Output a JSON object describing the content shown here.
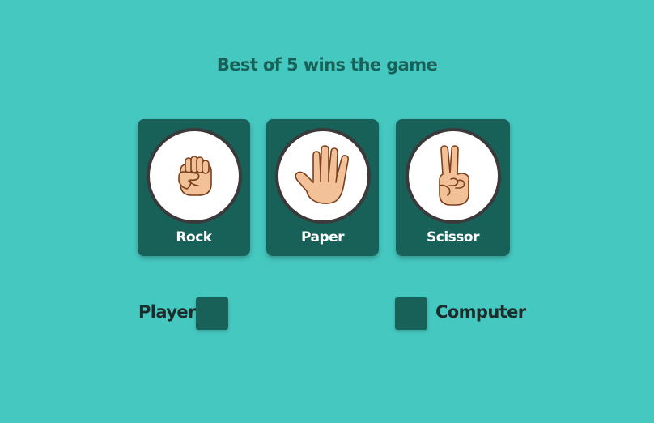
{
  "game": {
    "title": "Best of 5 wins the game"
  },
  "choices": [
    {
      "label": "Rock",
      "icon": "fist-hand-icon"
    },
    {
      "label": "Paper",
      "icon": "open-hand-icon"
    },
    {
      "label": "Scissor",
      "icon": "victory-hand-icon"
    }
  ],
  "scoreboard": {
    "player_label": "Player",
    "player_score": "",
    "computer_label": "Computer",
    "computer_score": ""
  },
  "colors": {
    "background": "#45c8c0",
    "card": "#176159",
    "skin": "#f3c197",
    "outline": "#3a3a3a"
  }
}
